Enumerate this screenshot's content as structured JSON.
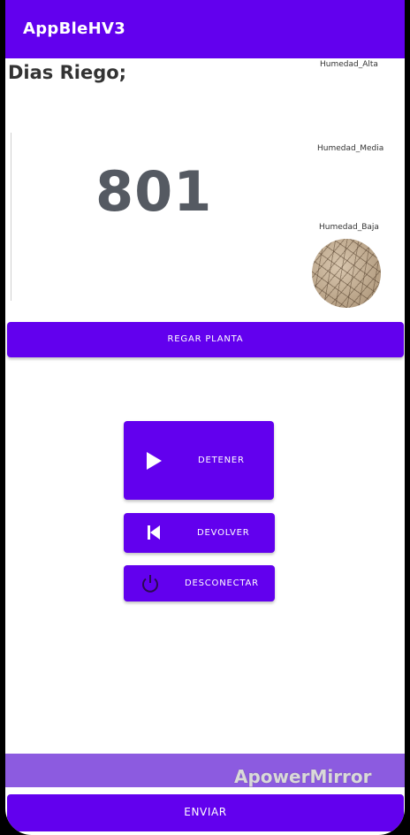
{
  "appbar": {
    "title": "AppBleHV3"
  },
  "main": {
    "dias_label": "Dias Riego;",
    "counter": "801",
    "humidity": {
      "alta": "Humedad_Alta",
      "media": "Humedad_Media",
      "baja": "Humedad_Baja"
    }
  },
  "buttons": {
    "regar": "REGAR PLANTA",
    "detener": "DETENER",
    "devolver": "DEVOLVER",
    "desconectar": "DESCONECTAR",
    "enviar": "ENVIAR"
  },
  "overlay": {
    "watermark": "ApowerMirror"
  },
  "icons": {
    "play": "play-icon",
    "previous": "skip-previous-icon",
    "power": "power-icon"
  },
  "colors": {
    "primary": "#6200ee",
    "input_bar": "#8c5be0",
    "counter_text": "#555a62"
  }
}
